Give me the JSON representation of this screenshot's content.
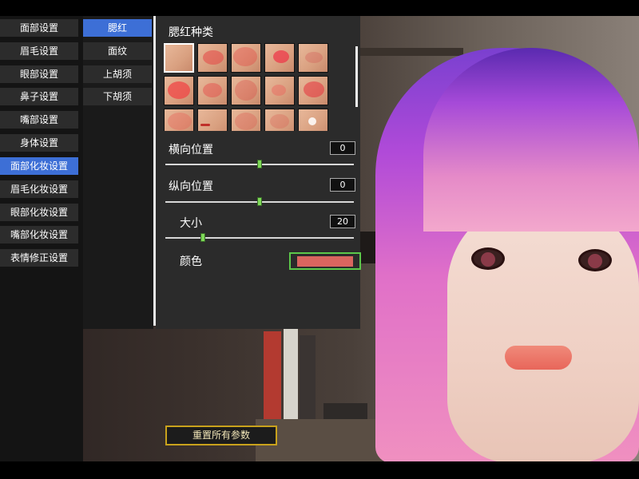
{
  "categories": [
    {
      "label": "面部设置",
      "active": false
    },
    {
      "label": "眉毛设置",
      "active": false
    },
    {
      "label": "眼部设置",
      "active": false
    },
    {
      "label": "鼻子设置",
      "active": false
    },
    {
      "label": "嘴部设置",
      "active": false
    },
    {
      "label": "身体设置",
      "active": false
    },
    {
      "label": "面部化妆设置",
      "active": true
    },
    {
      "label": "眉毛化妆设置",
      "active": false
    },
    {
      "label": "眼部化妆设置",
      "active": false
    },
    {
      "label": "嘴部化妆设置",
      "active": false
    },
    {
      "label": "表情修正设置",
      "active": false
    }
  ],
  "subcategories": [
    {
      "label": "腮红",
      "active": true
    },
    {
      "label": "面纹",
      "active": false
    },
    {
      "label": "上胡须",
      "active": false
    },
    {
      "label": "下胡须",
      "active": false
    }
  ],
  "panel": {
    "title": "腮红种类",
    "selected_thumbnail": 1,
    "thumbnail_count": 15,
    "sliders": [
      {
        "label": "横向位置",
        "value": "0",
        "level": 0.5
      },
      {
        "label": "纵向位置",
        "value": "0",
        "level": 0.5
      },
      {
        "label": "大小",
        "value": "20",
        "level": 0.2
      }
    ],
    "color_label": "颜色",
    "color_value": "#d9655f"
  },
  "reset_button": "重置所有参数",
  "colors": {
    "accent": "#3d6fd6",
    "handle": "#7ed957",
    "reset_border": "#c9a21c"
  }
}
